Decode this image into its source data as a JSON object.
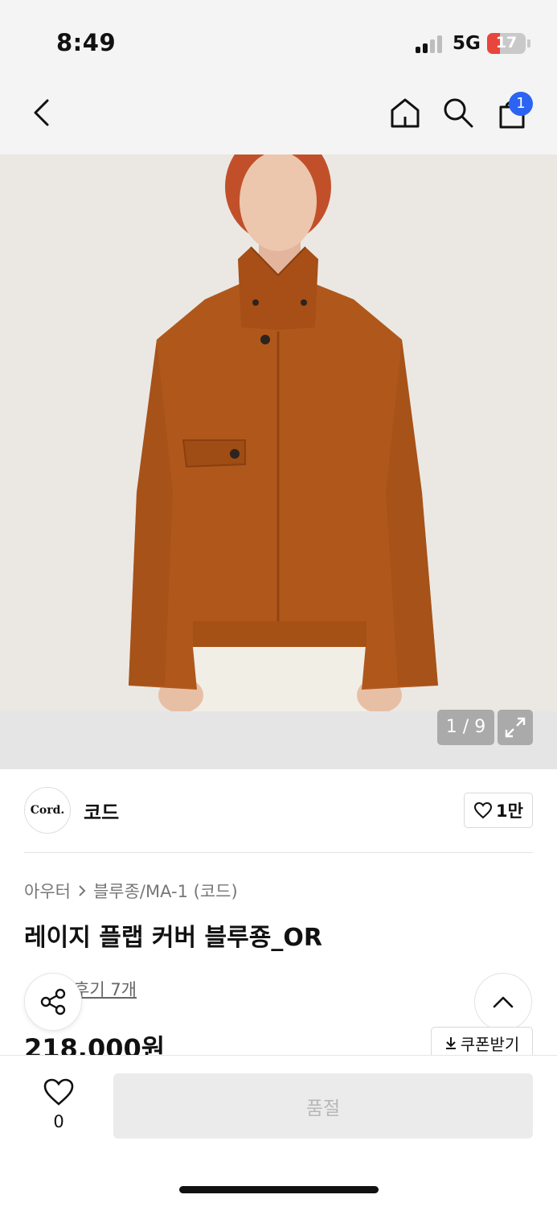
{
  "status_bar": {
    "time": "8:49",
    "network": "5G",
    "battery": "17"
  },
  "nav": {
    "cart_count": "1",
    "icons": [
      "chevron-left-icon",
      "home-icon",
      "search-icon",
      "shopping-bag-icon"
    ]
  },
  "gallery": {
    "pager": "1 / 9",
    "image_alt": "orange flap cover blouson worn by model"
  },
  "brand": {
    "logo_text": "Cord.",
    "name": "코드",
    "like_count": "1만"
  },
  "product": {
    "breadcrumb": [
      "아우터",
      "블루종/MA-1 (코드)"
    ],
    "title": "레이지 플랩 커버 블루죵_OR",
    "review_text": "후기 7개",
    "price": "218,000원",
    "coupon_label": "쿠폰받기"
  },
  "bottom_bar": {
    "wish_count": "0",
    "buy_label": "품절"
  },
  "colors": {
    "accent": "#2b64f3",
    "battery_low": "#e8453c",
    "jacket": "#b0581c",
    "disabled_bg": "#ebebeb"
  }
}
